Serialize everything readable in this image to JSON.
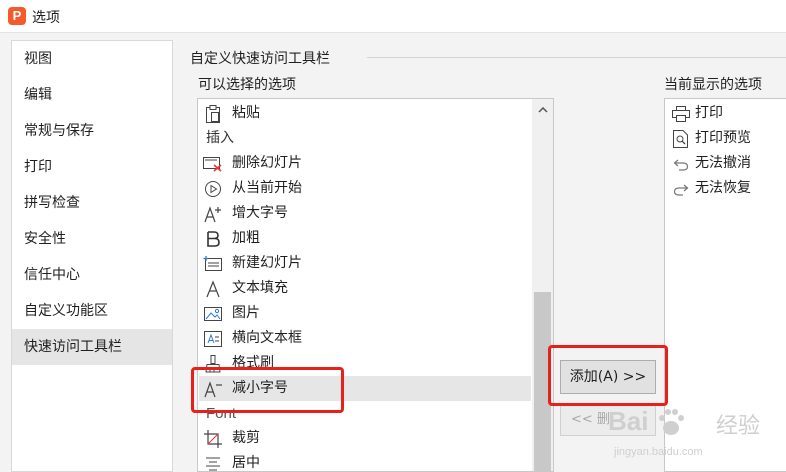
{
  "window": {
    "title": "选项",
    "app_icon_glyph": "P"
  },
  "sidebar": {
    "items": [
      {
        "label": "视图"
      },
      {
        "label": "编辑"
      },
      {
        "label": "常规与保存"
      },
      {
        "label": "打印"
      },
      {
        "label": "拼写检查"
      },
      {
        "label": "安全性"
      },
      {
        "label": "信任中心"
      },
      {
        "label": "自定义功能区"
      },
      {
        "label": "快速访问工具栏",
        "selected": true
      }
    ]
  },
  "main": {
    "group_title": "自定义快速访问工具栏",
    "available_label": "可以选择的选项",
    "current_label": "当前显示的选项",
    "available_items": [
      {
        "label": "粘贴",
        "icon": "paste-icon"
      },
      {
        "label": "插入",
        "header": true
      },
      {
        "label": "删除幻灯片",
        "icon": "delete-slide-icon"
      },
      {
        "label": "从当前开始",
        "icon": "play-from-current-icon"
      },
      {
        "label": "增大字号",
        "icon": "increase-font-icon"
      },
      {
        "label": "加粗",
        "icon": "bold-icon"
      },
      {
        "label": "新建幻灯片",
        "icon": "new-slide-icon"
      },
      {
        "label": "文本填充",
        "icon": "text-fill-icon"
      },
      {
        "label": "图片",
        "icon": "picture-icon"
      },
      {
        "label": "横向文本框",
        "icon": "textbox-icon"
      },
      {
        "label": "格式刷",
        "icon": "format-painter-icon"
      },
      {
        "label": "减小字号",
        "icon": "decrease-font-icon",
        "selected": true
      },
      {
        "label": "Font",
        "header": true
      },
      {
        "label": "裁剪",
        "icon": "crop-icon"
      },
      {
        "label": "居中",
        "icon": "align-center-icon"
      }
    ],
    "current_items": [
      {
        "label": "打印",
        "icon": "printer-icon"
      },
      {
        "label": "打印预览",
        "icon": "print-preview-icon"
      },
      {
        "label": "无法撤消",
        "icon": "undo-icon"
      },
      {
        "label": "无法恢复",
        "icon": "redo-icon"
      }
    ],
    "add_button": "添加(A) >>",
    "remove_button_partial": "<< 删"
  },
  "watermark": {
    "brand": "Bai",
    "brand_cn": "经验",
    "url": "jingyan.baidu.com"
  },
  "colors": {
    "highlight": "#e8201a",
    "app_icon": "#f45a2b"
  }
}
